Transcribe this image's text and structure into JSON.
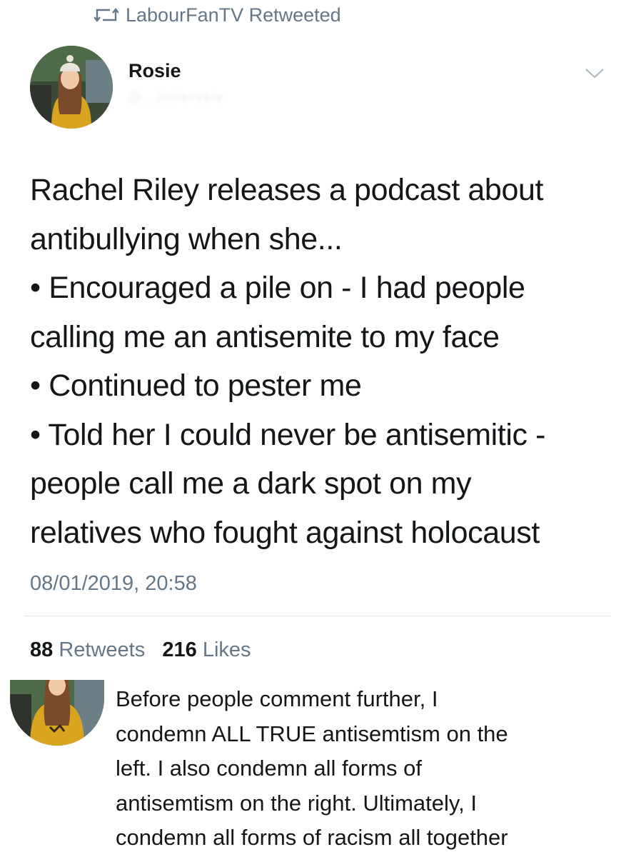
{
  "retweet_banner": {
    "label": "LabourFanTV Retweeted",
    "icon": "retweet-icon"
  },
  "tweet": {
    "author_name": "Rosie",
    "author_handle_blurred": "@...littlerosie",
    "lines": [
      "Rachel Riley releases a podcast about",
      "antibullying when she...",
      "• Encouraged a pile on - I had people",
      "calling me an antisemite to my face",
      "• Continued to pester me",
      "• Told her I could never be antisemitic -",
      "people call me a dark spot on my",
      "relatives who fought against holocaust"
    ],
    "timestamp": "08/01/2019, 20:58",
    "retweets_count": "88",
    "retweets_label": "Retweets",
    "likes_count": "216",
    "likes_label": "Likes"
  },
  "reply": {
    "lines": [
      "Before people comment further, I",
      "condemn ALL TRUE antisemtism on the",
      "left. I also condemn all forms of",
      "antisemtism on the right. Ultimately, I",
      "condemn all forms of racism all together"
    ]
  },
  "colors": {
    "text": "#14171a",
    "secondary": "#657786",
    "divider": "#e1e8ed",
    "coat": "#d9a520"
  }
}
